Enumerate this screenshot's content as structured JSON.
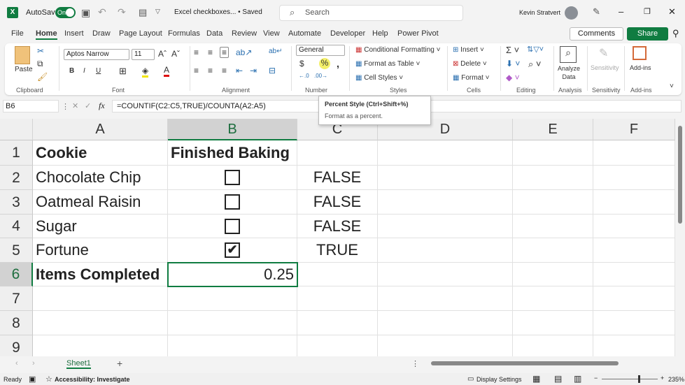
{
  "titlebar": {
    "autosave_label": "AutoSave",
    "autosave_state": "On",
    "doc_title": "Excel checkboxes... • Saved",
    "search_placeholder": "Search",
    "user": "Kevin Stratvert"
  },
  "menu": {
    "tabs": [
      "File",
      "Home",
      "Insert",
      "Draw",
      "Page Layout",
      "Formulas",
      "Data",
      "Review",
      "View",
      "Automate",
      "Developer",
      "Help",
      "Power Pivot"
    ],
    "active": "Home",
    "comments": "Comments",
    "share": "Share"
  },
  "ribbon": {
    "clipboard": {
      "label": "Clipboard",
      "paste": "Paste"
    },
    "font": {
      "label": "Font",
      "font_name": "Aptos Narrow",
      "font_size": "11"
    },
    "alignment": {
      "label": "Alignment"
    },
    "number": {
      "label": "Number",
      "format": "General"
    },
    "styles": {
      "label": "Styles",
      "conditional": "Conditional Formatting",
      "format_table": "Format as Table",
      "cell_styles": "Cell Styles"
    },
    "cells": {
      "label": "Cells",
      "insert": "Insert",
      "delete": "Delete",
      "format": "Format"
    },
    "editing": {
      "label": "Editing"
    },
    "analysis": {
      "label": "Analysis",
      "analyze": "Analyze Data"
    },
    "sensitivity": {
      "label": "Sensitivity",
      "button": "Sensitivity"
    },
    "addins": {
      "label": "Add-ins",
      "button": "Add-ins"
    }
  },
  "tooltip": {
    "title": "Percent Style (Ctrl+Shift+%)",
    "desc": "Format as a percent."
  },
  "formula_bar": {
    "name_box": "B6",
    "formula": "=COUNTIF(C2:C5,TRUE)/COUNTA(A2:A5)"
  },
  "sheet": {
    "columns": [
      "A",
      "B",
      "C",
      "D",
      "E",
      "F"
    ],
    "rows": [
      "1",
      "2",
      "3",
      "4",
      "5",
      "6",
      "7",
      "8",
      "9"
    ],
    "header": {
      "a": "Cookie",
      "b": "Finished Baking"
    },
    "items": [
      {
        "name": "Chocolate Chip",
        "checked": false,
        "value": "FALSE"
      },
      {
        "name": "Oatmeal Raisin",
        "checked": false,
        "value": "FALSE"
      },
      {
        "name": "Sugar",
        "checked": false,
        "value": "FALSE"
      },
      {
        "name": "Fortune",
        "checked": true,
        "value": "TRUE"
      }
    ],
    "summary_label": "Items Completed",
    "summary_value": "0.25",
    "selected": "B6"
  },
  "sheet_tabs": [
    "Sheet1"
  ],
  "status": {
    "ready": "Ready",
    "accessibility": "Accessibility: Investigate",
    "display": "Display Settings",
    "zoom": "235%"
  },
  "colors": {
    "accent": "#107c41"
  }
}
